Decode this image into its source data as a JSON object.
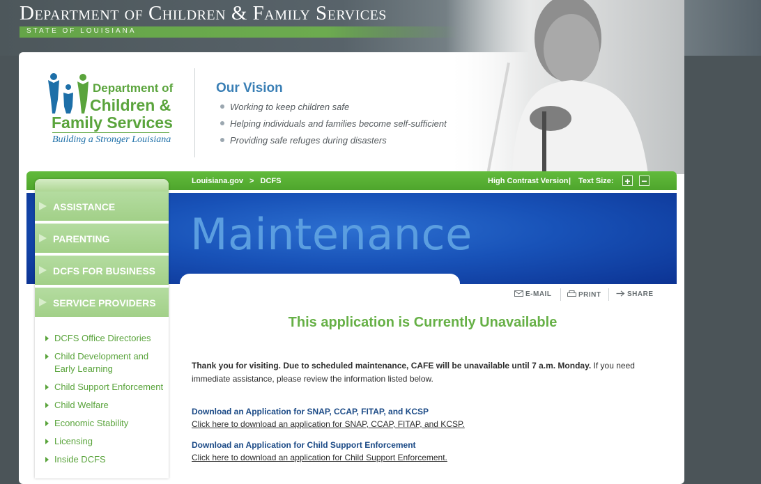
{
  "banner": {
    "title": "Department of Children & Family Services",
    "state": "STATE OF LOUISIANA"
  },
  "logo": {
    "line1": "Department of",
    "line2": "Children &",
    "line3": "Family Services",
    "tagline": "Building a Stronger Louisiana"
  },
  "vision": {
    "title": "Our Vision",
    "items": [
      "Working to keep children safe",
      "Helping individuals and families become self-sufficient",
      "Providing safe refuges during disasters"
    ]
  },
  "navbar": {
    "breadcrumb": [
      "Louisiana.gov",
      ">",
      "DCFS"
    ],
    "high_contrast": "High Contrast Version",
    "separator": "|",
    "text_size_label": "Text Size:",
    "increase": "+",
    "decrease": "−"
  },
  "page_banner": {
    "title": "Maintenance"
  },
  "sidebar": {
    "main_items": [
      "ASSISTANCE",
      "PARENTING",
      "DCFS FOR BUSINESS",
      "SERVICE PROVIDERS"
    ],
    "links": [
      "DCFS Office Directories",
      "Child Development and",
      "Early Learning",
      "Child Support Enforcement",
      "Child Welfare",
      "Economic Stability",
      "Licensing",
      "Inside DCFS"
    ]
  },
  "tools": {
    "email": "E-MAIL",
    "print": "PRINT",
    "share": "SHARE"
  },
  "content": {
    "heading": "This application is Currently Unavailable",
    "notice_bold": "Thank you for visiting. Due to scheduled maintenance, CAFE will be unavailable until 7 a.m. Monday.",
    "notice_rest": " If you need immediate assistance, please review the information listed below.",
    "downloads": [
      {
        "heading": "Download an Application for SNAP, CCAP, FITAP, and KCSP",
        "link": "Click here to download an application for SNAP, CCAP, FITAP, and KCSP."
      },
      {
        "heading": "Download an Application for Child Support Enforcement",
        "link": "Click here to download an application for Child Support Enforcement."
      }
    ]
  },
  "colors": {
    "brand_green": "#5aa43c",
    "brand_blue": "#1852b8",
    "heading_green": "#66b046",
    "link_blue": "#1b4a86"
  }
}
